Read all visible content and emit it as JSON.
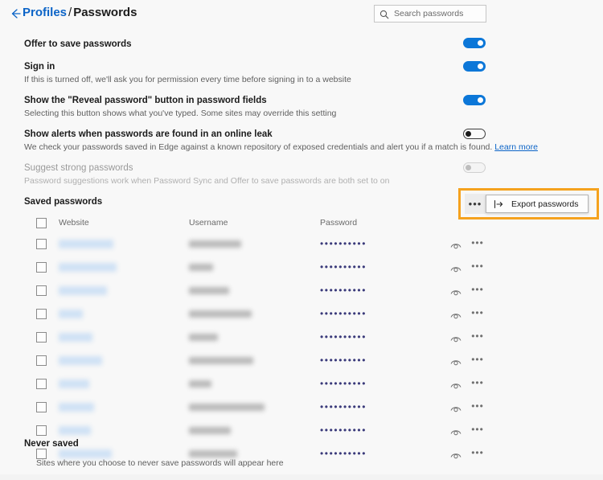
{
  "header": {
    "back_icon": "back-arrow-icon",
    "breadcrumb_parent": "Profiles",
    "breadcrumb_separator": "/",
    "breadcrumb_current": "Passwords",
    "search": {
      "icon": "search-icon",
      "placeholder": "Search passwords",
      "value": ""
    }
  },
  "settings": [
    {
      "title": "Offer to save passwords",
      "description": "",
      "toggle": "on"
    },
    {
      "title": "Sign in",
      "description": "If this is turned off, we'll ask you for permission every time before signing in to a website",
      "toggle": "on"
    },
    {
      "title": "Show the \"Reveal password\" button in password fields",
      "description": "Selecting this button shows what you've typed. Some sites may override this setting",
      "toggle": "on"
    },
    {
      "title": "Show alerts when passwords are found in an online leak",
      "description": "We check your passwords saved in Edge against a known repository of exposed credentials and alert you if a match is found.",
      "link": "Learn more",
      "toggle": "off"
    },
    {
      "title": "Suggest strong passwords",
      "description": "Password suggestions work when Password Sync and Offer to save passwords are both set to on",
      "toggle": "disabled"
    }
  ],
  "saved_passwords": {
    "section_title": "Saved passwords",
    "more_button": {
      "icon": "ellipsis-horizontal-icon",
      "label": "•••"
    },
    "menu": {
      "icon": "export-icon",
      "label": "Export passwords"
    },
    "columns": {
      "website": "Website",
      "username": "Username",
      "password": "Password"
    },
    "password_mask": "••••••••••",
    "rows": [
      {
        "site_width": 68,
        "user_width": 65
      },
      {
        "site_width": 72,
        "user_width": 30
      },
      {
        "site_width": 60,
        "user_width": 50
      },
      {
        "site_width": 30,
        "user_width": 78
      },
      {
        "site_width": 42,
        "user_width": 36
      },
      {
        "site_width": 54,
        "user_width": 80
      },
      {
        "site_width": 38,
        "user_width": 28
      },
      {
        "site_width": 44,
        "user_width": 94
      },
      {
        "site_width": 40,
        "user_width": 52
      },
      {
        "site_width": 66,
        "user_width": 60
      }
    ]
  },
  "never_saved": {
    "title": "Never saved",
    "description": "Sites where you choose to never save passwords will appear here"
  },
  "colors": {
    "accent": "#0c77d8",
    "link": "#0c64c7",
    "highlight": "#f5a21e",
    "background": "#f8f8f8"
  }
}
